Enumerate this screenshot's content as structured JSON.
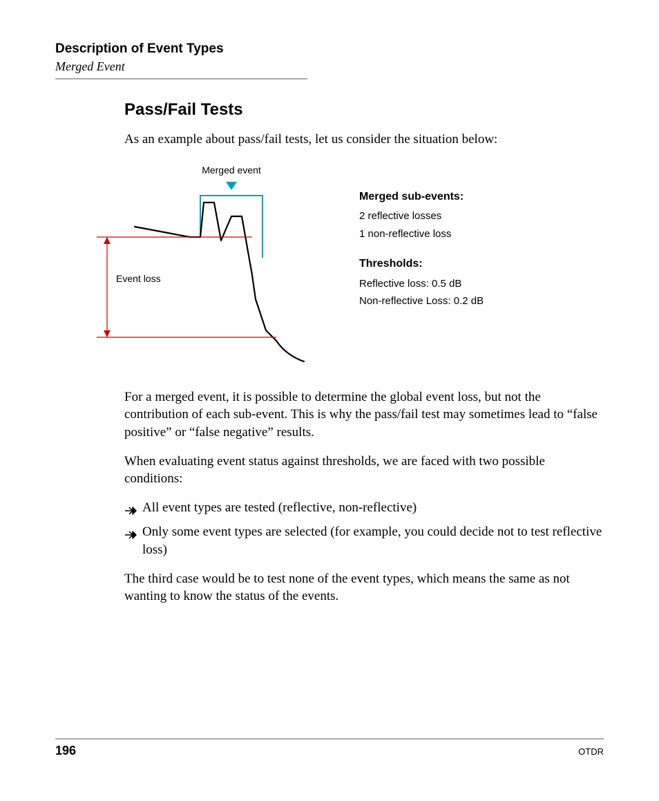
{
  "header": {
    "chapter": "Description of Event Types",
    "subchapter": "Merged Event"
  },
  "section": {
    "title": "Pass/Fail Tests",
    "intro": "As an example about pass/fail tests, let us consider the situation below:"
  },
  "figure": {
    "merged_label": "Merged event",
    "event_loss_label": "Event loss",
    "sub_heading": "Merged sub-events:",
    "sub_line1": "2 reflective losses",
    "sub_line2": "1 non-reflective loss",
    "thr_heading": "Thresholds:",
    "thr_line1": "Reflective loss: 0.5 dB",
    "thr_line2": "Non-reflective Loss: 0.2 dB"
  },
  "paragraphs": {
    "p1": "For a merged event, it is possible to determine the global event loss, but not the contribution of each sub-event. This is why the pass/fail test may sometimes lead to “false positive” or “false negative” results.",
    "p2": "When evaluating event status against thresholds, we are faced with two possible conditions:",
    "p3": "The third case would be to test none of the event types, which means the same as not wanting to know the status of the events."
  },
  "bullets": {
    "b1": "All event types are tested (reflective, non-reflective)",
    "b2": "Only some event types are selected (for example, you could decide not to test reflective loss)"
  },
  "footer": {
    "page": "196",
    "doc": "OTDR"
  },
  "colors": {
    "cyan": "#009FC3",
    "red": "#D00000"
  }
}
